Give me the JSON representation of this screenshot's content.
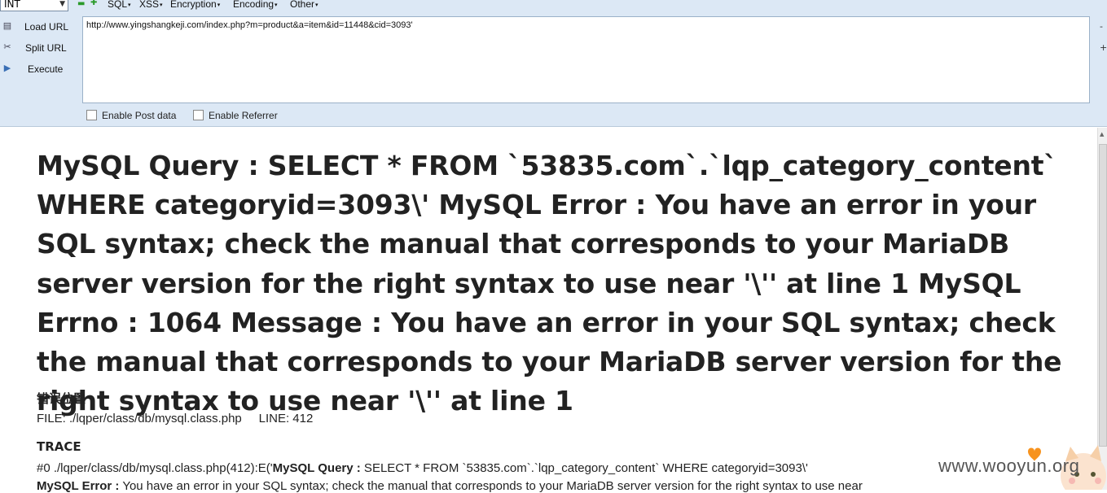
{
  "toolbar": {
    "type_select": "INT",
    "menus": [
      "SQL",
      "XSS",
      "Encryption",
      "Encoding",
      "Other"
    ],
    "side_buttons": [
      {
        "label": "Load URL",
        "icon": "load-url-icon"
      },
      {
        "label": "Split URL",
        "icon": "split-url-icon"
      },
      {
        "label": "Execute",
        "icon": "execute-icon"
      }
    ],
    "url_value": "http://www.yingshangkeji.com/index.php?m=product&a=item&id=11448&cid=3093'",
    "right_glyphs": [
      "-",
      "+"
    ],
    "enable_post_label": "Enable Post data",
    "enable_referrer_label": "Enable Referrer",
    "accent_color": "#dce8f5"
  },
  "page": {
    "error_message": "MySQL Query : SELECT * FROM `53835.com`.`lqp_category_content` WHERE categoryid=3093\\' MySQL Error : You have an error in your SQL syntax; check the manual that corresponds to your MariaDB server version for the right syntax to use near '\\'' at line 1 MySQL Errno : 1064 Message : You have an error in your SQL syntax; check the manual that corresponds to your MariaDB server version for the right syntax to use near '\\'' at line 1",
    "error_position_heading": "错误位置",
    "file_line": "FILE: ./lqper/class/db/mysql.class.php     LINE: 412",
    "trace_heading": "TRACE",
    "trace_line_prefix": "#0 ./lqper/class/db/mysql.class.php(412):E('",
    "trace_query_label": "MySQL Query :",
    "trace_query_value": " SELECT * FROM `53835.com`.`lqp_category_content` WHERE categoryid=3093\\'",
    "trace_error_label": "MySQL Error :",
    "trace_error_value": " You have an error in your SQL syntax; check the manual that corresponds to your MariaDB server version for the right syntax to use near"
  },
  "watermark": {
    "text": "www.wooyun.org",
    "icon": "wooyun-cat-icon"
  }
}
